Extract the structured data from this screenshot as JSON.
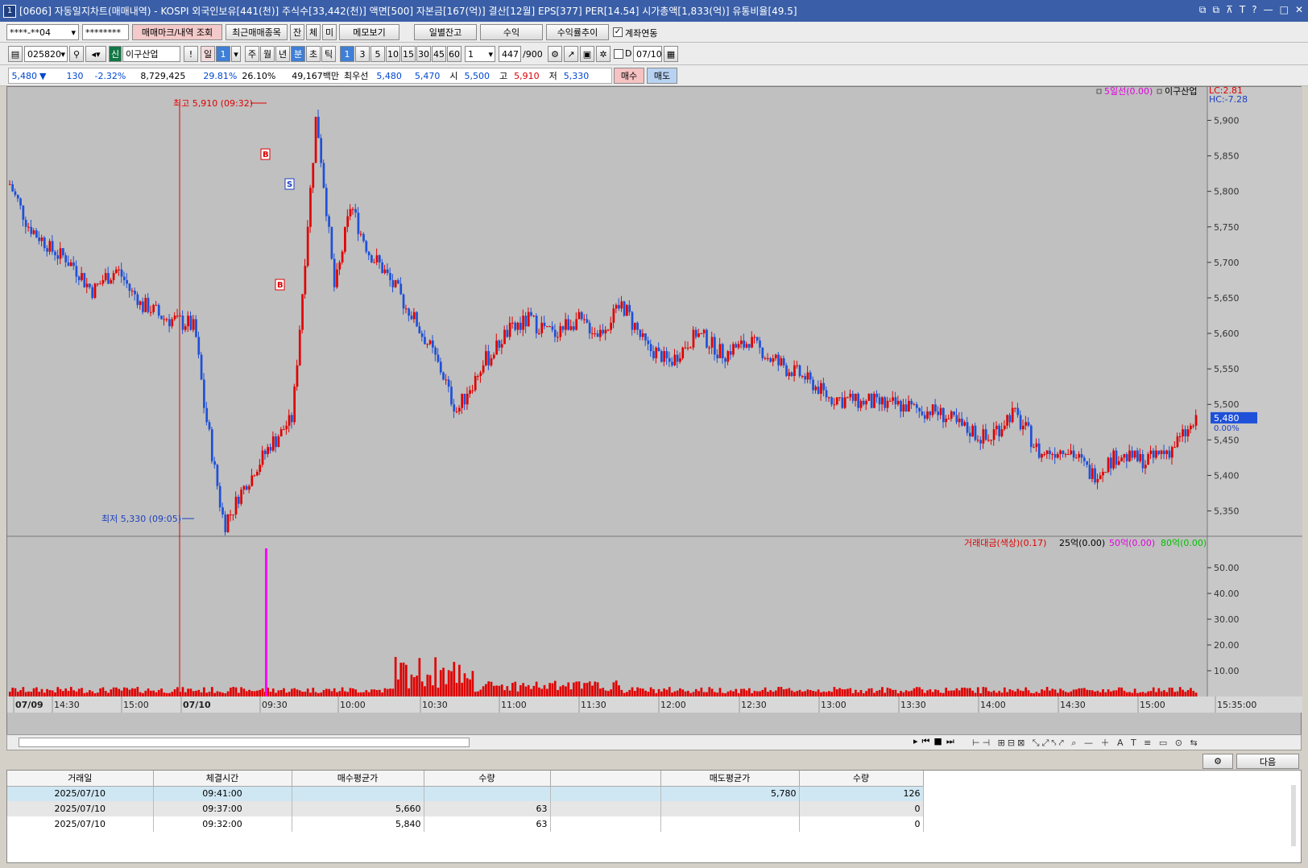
{
  "window": {
    "badge": "1",
    "title": "[0606] 자동일지차트(매매내역) - KOSPI 외국인보유[441(천)] 주식수[33,442(천)] 액면[500] 자본금[167(억)] 결산[12월] EPS[377] PER[14.54] 시가총액[1,833(억)] 유통비율[49.5]",
    "buttons": [
      "⧉",
      "⧉",
      "⊼",
      "T",
      "?",
      "—",
      "□",
      "✕"
    ]
  },
  "toolbar1": {
    "account": "****-**04",
    "password": "********",
    "btn_mark": "매매마크/내역 조회",
    "btn_recent": "최근매매종목",
    "btn_jan": "잔",
    "btn_che": "체",
    "btn_mi": "미",
    "btn_memo": "메모보기",
    "btn_daily": "일별잔고",
    "btn_profit": "수익",
    "btn_rate": "수익률추이",
    "chk_link": "계좌연동"
  },
  "toolbar2": {
    "code": "025820",
    "sin": "신",
    "stock_name": "이구산업",
    "excl": "!",
    "period_day": "일",
    "period_num": "1",
    "periods": [
      "주",
      "월",
      "년",
      "분",
      "초",
      "틱"
    ],
    "selected_period": "분",
    "intervals": [
      "1",
      "3",
      "5",
      "10",
      "15",
      "30",
      "45",
      "60"
    ],
    "selected_interval": "1",
    "count_sel": "1",
    "count": "447",
    "count_max": "/900",
    "d_label": "D",
    "date": "07/10"
  },
  "quote": {
    "price": "5,480",
    "arrow": "▼",
    "change": "130",
    "pct": "-2.32%",
    "volume": "8,729,425",
    "ratio1": "29.81%",
    "ratio2": "26.10%",
    "amount": "49,167백만",
    "best_label": "최우선",
    "ask": "5,480",
    "bid": "5,470",
    "open_label": "시",
    "open": "5,500",
    "high_label": "고",
    "high": "5,910",
    "low_label": "저",
    "low": "5,330",
    "btn_buy": "매수",
    "btn_sell": "매도"
  },
  "chart": {
    "legend_ma": "5일선(0.00)",
    "legend_stock": "이구산업",
    "lc": "LC:2.81",
    "hc": "HC:-7.28",
    "price_labels": [
      "5,900",
      "5,850",
      "5,800",
      "5,750",
      "5,700",
      "5,650",
      "5,600",
      "5,550",
      "5,500",
      "5,450",
      "5,400",
      "5,350"
    ],
    "current_price_tag": "5,480",
    "current_pct_tag": "0.00%",
    "high_annot": "최고 5,910 (09:32)",
    "low_annot": "최저 5,330 (09:05)",
    "vol_legend_main": "거래대금(색상)(0.17)",
    "vol_legend_25": "25억(0.00)",
    "vol_legend_50": "50억(0.00)",
    "vol_legend_80": "80억(0.00)",
    "vol_labels": [
      "50.00",
      "40.00",
      "30.00",
      "20.00",
      "10.00"
    ],
    "time_labels": [
      "07/09",
      "14:30",
      "15:00",
      "07/10",
      "09:30",
      "10:00",
      "10:30",
      "11:00",
      "11:30",
      "12:00",
      "12:30",
      "13:00",
      "13:30",
      "14:00",
      "14:30",
      "15:00",
      "15:35:00"
    ],
    "colors": {
      "up": "#e00000",
      "down": "#1e50d8",
      "bg": "#c0c0c0",
      "spike": "#ff00ff"
    }
  },
  "chart_data": {
    "type": "candlestick",
    "symbol": "이구산업",
    "y_range": [
      5330,
      5910
    ],
    "ohlc_trace": [
      [
        "07/09 14:10",
        5810
      ],
      [
        "07/09 14:20",
        5750
      ],
      [
        "07/09 14:30",
        5720
      ],
      [
        "07/09 14:40",
        5700
      ],
      [
        "07/09 14:50",
        5660
      ],
      [
        "07/09 15:00",
        5690
      ],
      [
        "07/09 15:10",
        5640
      ],
      [
        "07/09 15:20",
        5620
      ],
      [
        "07/09 15:30",
        5610
      ],
      [
        "07/10 09:01",
        5500
      ],
      [
        "07/10 09:05",
        5330
      ],
      [
        "07/10 09:10",
        5380
      ],
      [
        "07/10 09:20",
        5440
      ],
      [
        "07/10 09:28",
        5480
      ],
      [
        "07/10 09:32",
        5910
      ],
      [
        "07/10 09:37",
        5660
      ],
      [
        "07/10 09:41",
        5780
      ],
      [
        "07/10 09:50",
        5720
      ],
      [
        "07/10 10:00",
        5680
      ],
      [
        "07/10 10:10",
        5620
      ],
      [
        "07/10 10:20",
        5550
      ],
      [
        "07/10 10:30",
        5490
      ],
      [
        "07/10 10:40",
        5550
      ],
      [
        "07/10 10:50",
        5600
      ],
      [
        "07/10 11:00",
        5620
      ],
      [
        "07/10 11:10",
        5600
      ],
      [
        "07/10 11:20",
        5620
      ],
      [
        "07/10 11:30",
        5600
      ],
      [
        "07/10 11:40",
        5640
      ],
      [
        "07/10 11:50",
        5580
      ],
      [
        "07/10 12:00",
        5560
      ],
      [
        "07/10 12:10",
        5600
      ],
      [
        "07/10 12:20",
        5570
      ],
      [
        "07/10 12:30",
        5590
      ],
      [
        "07/10 12:40",
        5560
      ],
      [
        "07/10 12:50",
        5540
      ],
      [
        "07/10 13:00",
        5510
      ],
      [
        "07/10 13:20",
        5500
      ],
      [
        "07/10 13:40",
        5490
      ],
      [
        "07/10 14:00",
        5450
      ],
      [
        "07/10 14:10",
        5490
      ],
      [
        "07/10 14:20",
        5430
      ],
      [
        "07/10 14:30",
        5440
      ],
      [
        "07/10 14:40",
        5400
      ],
      [
        "07/10 14:50",
        5430
      ],
      [
        "07/10 15:00",
        5420
      ],
      [
        "07/10 15:10",
        5440
      ],
      [
        "07/10 15:20",
        5480
      ]
    ],
    "trade_marks": [
      {
        "time": "09:32",
        "side": "B",
        "price": 5840
      },
      {
        "time": "09:37",
        "side": "B",
        "price": 5660
      },
      {
        "time": "09:41",
        "side": "S",
        "price": 5780
      }
    ]
  },
  "bottom_toolbar": {
    "btn_next": "다음"
  },
  "trades": {
    "headers": [
      "거래일",
      "체결시간",
      "매수평균가",
      "수량",
      "",
      "매도평균가",
      "수량"
    ],
    "rows": [
      [
        "2025/07/10",
        "09:41:00",
        "",
        "",
        "",
        "5,780",
        "126"
      ],
      [
        "2025/07/10",
        "09:37:00",
        "5,660",
        "63",
        "",
        "",
        "0"
      ],
      [
        "2025/07/10",
        "09:32:00",
        "5,840",
        "63",
        "",
        "",
        "0"
      ]
    ]
  }
}
